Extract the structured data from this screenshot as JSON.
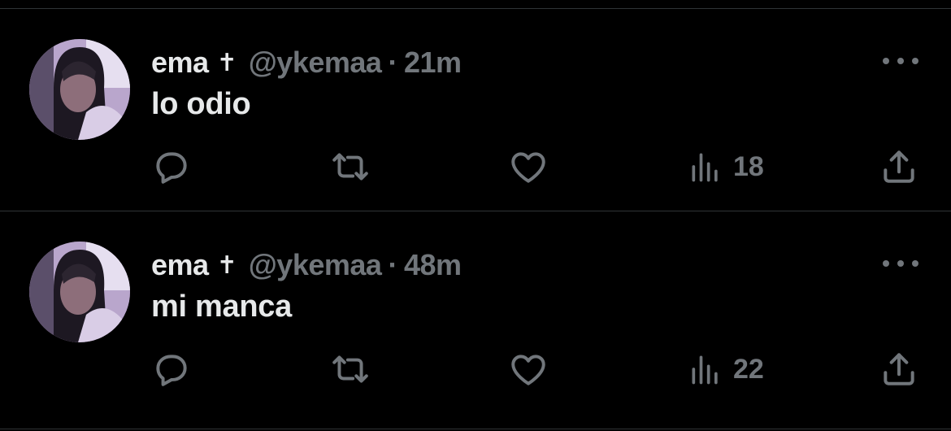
{
  "tweets": [
    {
      "author_name": "ema",
      "author_badge": "✝",
      "handle": "@ykemaa",
      "separator": "·",
      "time": "21m",
      "text": "lo odio",
      "views": "18"
    },
    {
      "author_name": "ema",
      "author_badge": "✝",
      "handle": "@ykemaa",
      "separator": "·",
      "time": "48m",
      "text": "mi manca",
      "views": "22"
    }
  ],
  "icons": {
    "reply": "reply-icon",
    "retweet": "retweet-icon",
    "like": "heart-icon",
    "views": "views-icon",
    "share": "share-icon",
    "more": "more-icon"
  },
  "colors": {
    "background": "#000000",
    "primary_text": "#e7e9ea",
    "secondary_text": "#71767b",
    "divider": "#2f3336"
  }
}
